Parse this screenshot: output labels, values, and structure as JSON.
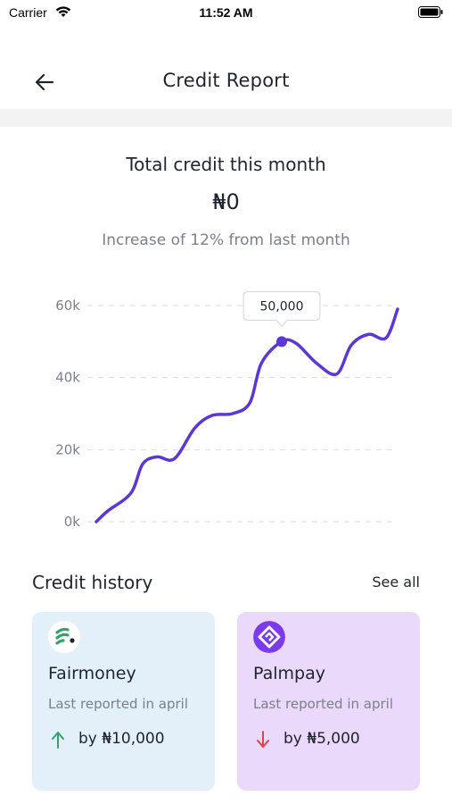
{
  "status_bar": {
    "carrier": "Carrier",
    "time": "11:52 AM"
  },
  "header": {
    "title": "Credit Report",
    "back_icon": "arrow-left-icon"
  },
  "summary": {
    "title": "Total credit this month",
    "amount": "₦0",
    "subtitle": "Increase of 12% from last month"
  },
  "chart_data": {
    "type": "line",
    "y_ticks": [
      "0k",
      "20k",
      "40k",
      "60k"
    ],
    "ylim": [
      0,
      60000
    ],
    "grid": true,
    "tooltip": {
      "label": "50,000",
      "value": 50000
    },
    "series": [
      {
        "color": "#5b37d6",
        "points": [
          [
            0,
            0
          ],
          [
            4,
            3000
          ],
          [
            12,
            8000
          ],
          [
            16,
            16000
          ],
          [
            21,
            18000
          ],
          [
            27,
            17500
          ],
          [
            34,
            26000
          ],
          [
            40,
            29500
          ],
          [
            47,
            30000
          ],
          [
            53,
            33000
          ],
          [
            57,
            44000
          ],
          [
            64,
            50000
          ],
          [
            69,
            49500
          ],
          [
            76,
            44000
          ],
          [
            83,
            41000
          ],
          [
            88,
            49000
          ],
          [
            94,
            52000
          ],
          [
            100,
            51000
          ],
          [
            104,
            59000
          ]
        ]
      }
    ]
  },
  "history": {
    "title": "Credit history",
    "see_all": "See all",
    "cards": [
      {
        "name": "Fairmoney",
        "subtitle": "Last reported in april",
        "change": "by ₦10,000",
        "direction": "up",
        "logo_icon": "fairmoney-logo-icon",
        "accent": "#2fa36b"
      },
      {
        "name": "Palmpay",
        "subtitle": "Last reported in april",
        "change": "by ₦5,000",
        "direction": "down",
        "logo_icon": "palmpay-logo-icon",
        "accent": "#7c3aed"
      }
    ]
  },
  "colors": {
    "up": "#2fa36b",
    "down": "#e2404b",
    "line": "#5b37d6"
  }
}
